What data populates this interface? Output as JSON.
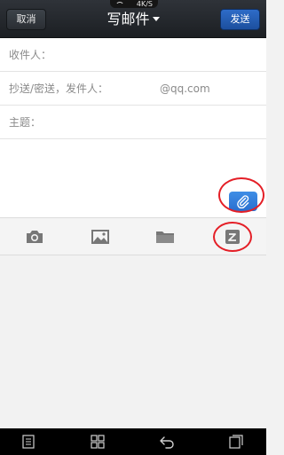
{
  "status": {
    "network_speed": "4K/S"
  },
  "header": {
    "cancel_label": "取消",
    "title": "写邮件",
    "send_label": "发送"
  },
  "form": {
    "to_label": "收件人：",
    "cc_label": "抄送/密送，发件人：",
    "sender_value": "@qq.com",
    "subject_label": "主题："
  },
  "toolbar": {
    "icons": [
      "camera-icon",
      "image-icon",
      "folder-icon",
      "note-icon"
    ]
  },
  "navbar": {
    "icons": [
      "menu-icon",
      "apps-icon",
      "back-icon",
      "recent-apps-icon"
    ]
  },
  "colors": {
    "header_bg": "#24282d",
    "send_blue": "#2a66c2",
    "attach_blue": "#3a86e0",
    "annotation_red": "#e41e26",
    "label_gray": "#8a8a8a"
  }
}
